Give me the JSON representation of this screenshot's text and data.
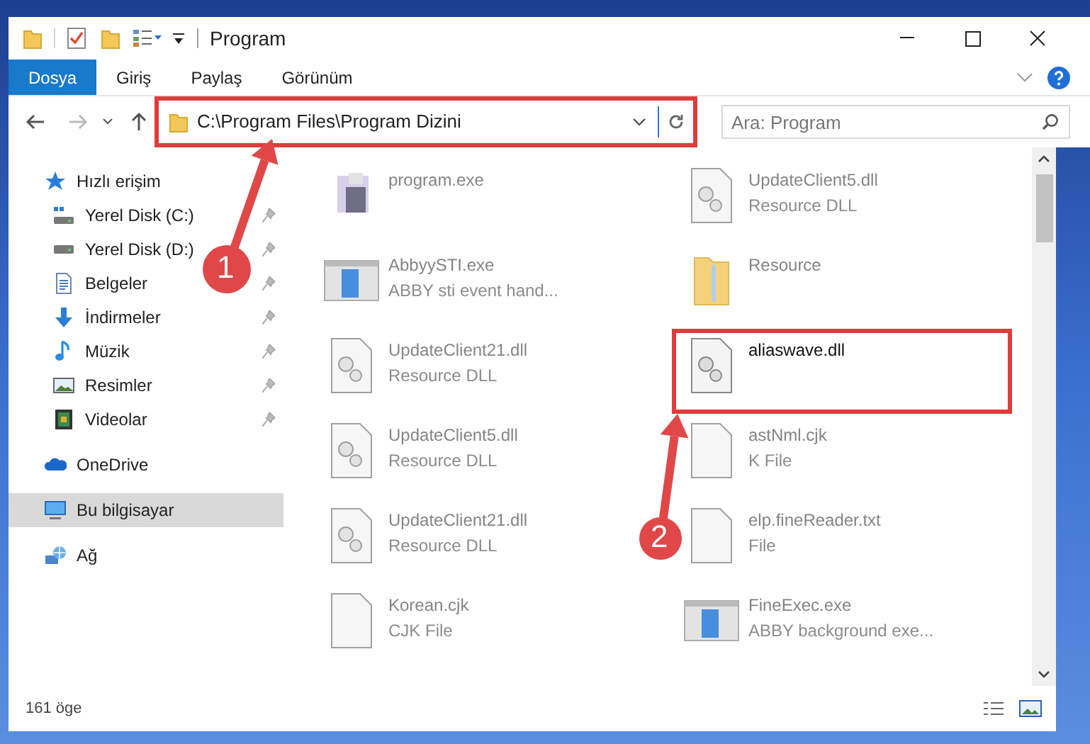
{
  "window": {
    "title": "Program"
  },
  "ribbon_tabs": [
    {
      "label": "Dosya",
      "selected": true
    },
    {
      "label": "Giriş",
      "selected": false
    },
    {
      "label": "Paylaş",
      "selected": false
    },
    {
      "label": "Görünüm",
      "selected": false
    }
  ],
  "address_bar": {
    "path": "C:\\Program Files\\Program Dizini",
    "outlined": true
  },
  "search": {
    "placeholder": "Ara: Program"
  },
  "nav_pane": [
    {
      "label": "Hızlı erişim",
      "kind": "star",
      "selected": false,
      "children": [
        {
          "label": "Yerel Disk (C:)",
          "kind": "drive-c",
          "selected": false,
          "pinned": true
        },
        {
          "label": "Yerel Disk (D:)",
          "kind": "drive",
          "selected": false,
          "pinned": true
        },
        {
          "label": "Belgeler",
          "kind": "docs",
          "selected": false,
          "pinned": true
        },
        {
          "label": "İndirmeler",
          "kind": "download",
          "selected": false,
          "pinned": true
        },
        {
          "label": "Müzik",
          "kind": "music",
          "selected": false,
          "pinned": true
        },
        {
          "label": "Resimler",
          "kind": "pictures",
          "selected": false,
          "pinned": true
        },
        {
          "label": "Videolar",
          "kind": "video",
          "selected": false,
          "pinned": true
        }
      ]
    },
    {
      "label": "OneDrive",
      "kind": "cloud",
      "selected": false
    },
    {
      "label": "Bu bilgisayar",
      "kind": "pc",
      "selected": true
    },
    {
      "label": "Ağ",
      "kind": "network",
      "selected": false
    }
  ],
  "files": [
    {
      "name": "program.exe",
      "kind": "app",
      "blurred": true,
      "outlined": false
    },
    {
      "name": "UpdateClient5.dll",
      "description": "Resource DLL",
      "kind": "dll",
      "blurred": true,
      "outlined": false
    },
    {
      "name": "AbbyySTI.exe",
      "description": "ABBY sti event hand...",
      "kind": "window",
      "blurred": true,
      "outlined": false
    },
    {
      "name": "Resource",
      "kind": "folder",
      "blurred": true,
      "outlined": false
    },
    {
      "name": "UpdateClient21.dll",
      "description": "Resource DLL",
      "kind": "dll",
      "blurred": true,
      "outlined": false
    },
    {
      "name": "aliaswave.dll",
      "kind": "dll",
      "blurred": false,
      "outlined": true
    },
    {
      "name": "UpdateClient5.dll",
      "description": "Resource DLL",
      "kind": "dll",
      "blurred": true,
      "outlined": false
    },
    {
      "name": "astNml.cjk",
      "description": "K File",
      "kind": "page",
      "blurred": true,
      "outlined": false
    },
    {
      "name": "UpdateClient21.dll",
      "description": "Resource DLL",
      "kind": "dll",
      "blurred": true,
      "outlined": false
    },
    {
      "name": "elp.fineReader.txt",
      "description": "File",
      "kind": "page",
      "blurred": true,
      "outlined": false
    },
    {
      "name": "Korean.cjk",
      "description": "CJK File",
      "kind": "page",
      "blurred": true,
      "outlined": false
    },
    {
      "name": "FineExec.exe",
      "description": "ABBY background exe...",
      "kind": "window",
      "blurred": true,
      "outlined": false
    }
  ],
  "status_bar": {
    "item_count": "161 öge"
  },
  "callouts": [
    {
      "number": "1"
    },
    {
      "number": "2"
    }
  ]
}
